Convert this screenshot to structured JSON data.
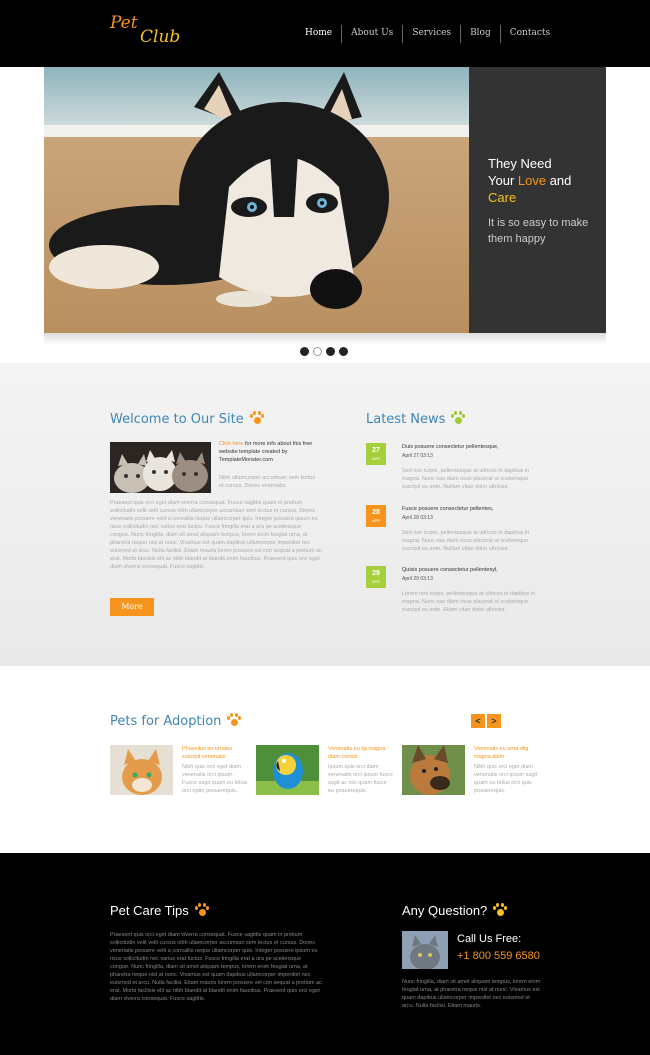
{
  "header": {
    "logo_pet": "Pet",
    "logo_club": "Club",
    "nav": [
      "Home",
      "About Us",
      "Services",
      "Blog",
      "Contacts"
    ]
  },
  "hero": {
    "line1": "They Need",
    "line2_pre": "Your ",
    "line2_love": "Love",
    "line2_post": " and",
    "line3": "Care",
    "subtitle": "It is so easy to make them happy",
    "slides_total": 4,
    "active_slide": 2
  },
  "welcome": {
    "title": "Welcome to Our Site",
    "link_text": "Click here",
    "intro": "for more info about this free website template created by TemplateMonster.com",
    "gray_intro": "Nibh ullamcorper accumsan sem lectus et cursus. Donec venenatis.",
    "body": "Praesent quis orci eget diam viverra consequat. Fusce sagittis quam in pretium sollicitudin velit velit cursus nibh ullamcorper accumsan sem lectus et cursus. Donec venenatis posuere velit a convallis neque ullamcorper quis. Integer posuere ipsum eu risus sollicitudin nec varius erat luctus. Fusce fringilla erat a ura pe scelerisque congue. Nunc fringilla, diam sit amet aliquam tempus, lorem enim feugiat urna, at pharetra neque nisl at nunc. Vivamus est quam dapibus ullamcorper imperdiet nec euismod et arcu. Nulla facilisi. Etiam mauris lorem posuere vel con sequat a pretium ac erat. Morbi facilisis elit ac nibh blandit at blandit enim faucibus. Praesent quis orci eget diam viverra consequat. Fusce sagittis.",
    "more_button": "More"
  },
  "news": {
    "title": "Latest News",
    "items": [
      {
        "day": "27",
        "month": "APR",
        "title": "Duis posuere consectetur pellentesque,",
        "meta": "April 27 03:13",
        "body": "Sed non turpis, pellentesque at ultrices in dapibus in magna. Nunc eas diam risus placerat ut scelerisque suscipit eu ante. Nullam vitae dolor ultricies."
      },
      {
        "day": "28",
        "month": "APR",
        "title": "Fusce posuere consectetur pellentes,",
        "meta": "April 28 03:13",
        "body": "Sed non turpis, pellentesque at ultrices in dapibus in magna. Nunc eas diam risus placerat ut scelerisque suscipit eu ante. Nullam vitae dolor ultricies."
      },
      {
        "day": "29",
        "month": "APR",
        "title": "Quisis posuere consectetur pellentesyl,",
        "meta": "April 29 03:13",
        "body": "Lorem non turpis, pellentesque at ultrices in dapibus in magna. Nunc eas diam risus placerat ut scelerisque suscipit eu ante. Etiam vitae dolor ultricies."
      }
    ]
  },
  "adoption": {
    "title": "Pets for Adoption",
    "prev_arrow": "<",
    "next_arrow": ">",
    "pets": [
      {
        "link": "Phasellus eu urnaeu suscipit venenatis",
        "desc": "Nibh quis orci eget diam venenatis orci ipsum. Fusce sagit quam eu tellus orci optio posuerequis."
      },
      {
        "link": "Venenatis eu lig magna diam cursus",
        "desc": "Ipsum quis orci diam venenatis orci ipsum fusce sagit ac nisi quam fusce eu posuerequis."
      },
      {
        "link": "Venenatis eu urna dlig magna diam",
        "desc": "Nibh quis orci eget diam venenatis orci ipsum sagit quam eu tellus orci quis posuerequis."
      }
    ]
  },
  "footer": {
    "tips_title": "Pet Care Tips",
    "tips_body": "Praesent quis orci eget diam viverra consequat. Fusce sagittis quam in pretium sollicitudin velit velit cursus nibh ullamcorper accumsan sem lectus et cursus. Donec venenatis posuere velit a convallis neque ullamcorper quis. Integer posuere ipsum eu risus sollicitudin nec varius erat luctus. Fusce fringilla erat a ura pe scelerisque congue. Nunc fringilla, diam sit amet aliquam tempus, lorem enim feugiat urna, at pharetra neque nisl at nunc. Vivamus est quam dapibus ullamcorper imperdiet nec euismod et arcu. Nulla facilisi. Etiam mauris lorem posuere vel con sequat a pretium ac erat. Morbi facilisis elit ac nibh blandit at blandit enim faucibus. Praesent quis orci eget diam viverra consequat. Fusce sagittis.",
    "question_title": "Any Question?",
    "call_label": "Call Us Free:",
    "phone": "+1 800 559 6580",
    "question_body": "Nunc fringilla, diam sit amet aliquam tempus, lorem enim feugiat urna, at pharetra neque nisl at nunc. Vivamus est quam dapibus ullamcorper imperdiet nec euismod et arcu. Nulla facilisi. Etiam mauris."
  },
  "colors": {
    "accent_orange": "#f7941d",
    "accent_yellow": "#f7c31d",
    "title_blue": "#3f86b4",
    "news_green": "#a6cf3c"
  }
}
